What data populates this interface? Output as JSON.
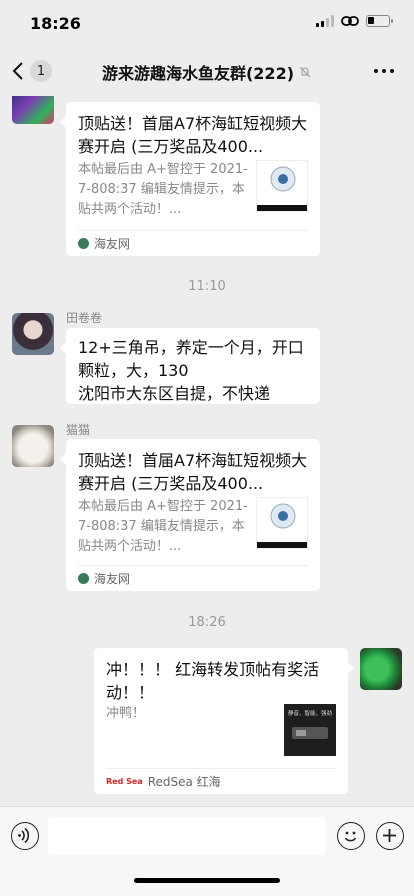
{
  "status": {
    "time": "18:26"
  },
  "nav": {
    "unread_count": "1",
    "title": "游来游趣海水鱼友群(222)"
  },
  "messages": [
    {
      "type": "link-card",
      "title": "顶贴送！首届A7杯海缸短视频大赛开启 (三万奖品及400...",
      "desc": "本帖最后由 A+智控于 2021-7-808:37 编辑友情提示，本贴共两个活动！...",
      "source": "海友网"
    },
    {
      "type": "time",
      "text": "11:10"
    },
    {
      "type": "text",
      "sender": "田卷卷",
      "lines": [
        "12+三角吊，养定一个月，开口颗粒，大，130",
        "沈阳市大东区自提，不快递"
      ]
    },
    {
      "type": "link-card",
      "sender": "猫猫",
      "title": "顶贴送！首届A7杯海缸短视频大赛开启 (三万奖品及400...",
      "desc": "本帖最后由 A+智控于 2021-7-808:37 编辑友情提示，本贴共两个活动！...",
      "source": "海友网"
    },
    {
      "type": "time",
      "text": "18:26"
    },
    {
      "type": "link-card-self",
      "title": "冲！！！ 红海转发顶帖有奖活动！！",
      "desc": "冲鸭！",
      "thumb_text": "静音、智能、强劲",
      "source": "RedSea 红海",
      "source_logo": "Red Sea"
    }
  ],
  "input": {
    "placeholder": ""
  },
  "colors": {
    "bg": "#ededed",
    "bubble": "#ffffff",
    "muted": "#888888"
  }
}
